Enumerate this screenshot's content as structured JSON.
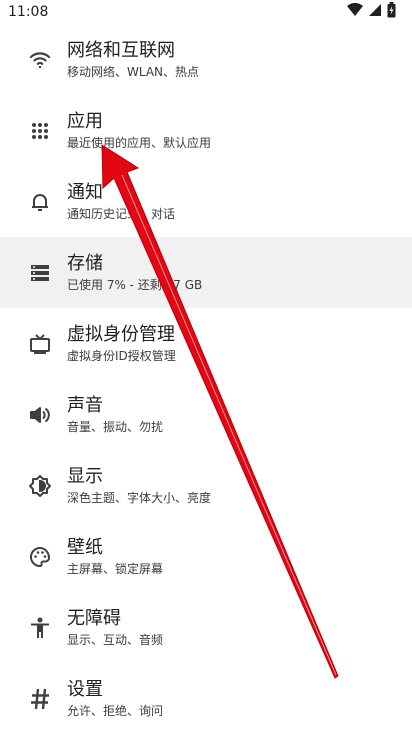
{
  "status_bar": {
    "time": "11:08",
    "icons": [
      "wifi-icon",
      "signal-icon",
      "battery-icon"
    ]
  },
  "settings": [
    {
      "title": "网络和互联网",
      "subtitle": "移动网络、WLAN、热点",
      "icon": "wifi-icon"
    },
    {
      "title": "应用",
      "subtitle": "最近使用的应用、默认应用",
      "icon": "apps-grid-icon"
    },
    {
      "title": "通知",
      "subtitle": "通知历史记录、对话",
      "icon": "bell-icon"
    },
    {
      "title": "存储",
      "subtitle": "已使用 7% - 还剩 27 GB",
      "icon": "storage-icon"
    },
    {
      "title": "虚拟身份管理",
      "subtitle": "虚拟身份ID授权管理",
      "icon": "tv-icon"
    },
    {
      "title": "声音",
      "subtitle": "音量、振动、勿扰",
      "icon": "speaker-icon"
    },
    {
      "title": "显示",
      "subtitle": "深色主题、字体大小、亮度",
      "icon": "brightness-icon"
    },
    {
      "title": "壁纸",
      "subtitle": "主屏幕、锁定屏幕",
      "icon": "palette-icon"
    },
    {
      "title": "无障碍",
      "subtitle": "显示、互动、音频",
      "icon": "accessibility-icon"
    },
    {
      "title": "设置",
      "subtitle": "允许、拒绝、询问",
      "icon": "hash-icon"
    }
  ],
  "colors": {
    "arrow": "#e30613",
    "highlight": "#f1f1f1",
    "icon": "#3c4043"
  }
}
